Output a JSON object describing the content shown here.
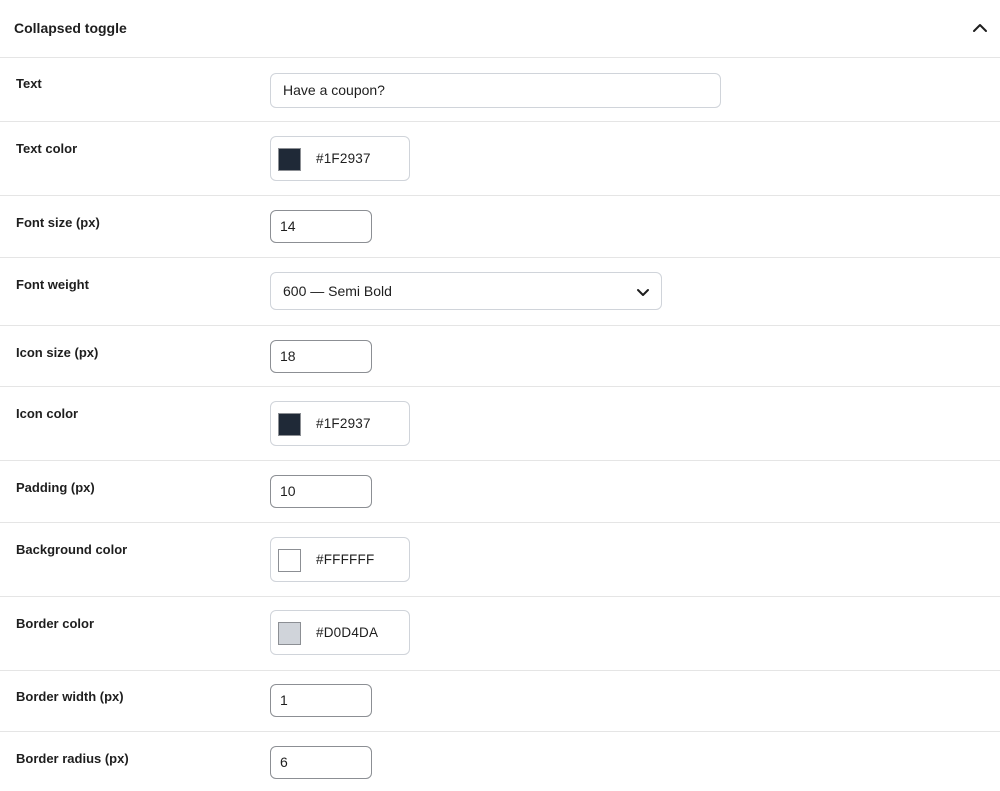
{
  "panel": {
    "title": "Collapsed toggle",
    "collapse_icon": "chevron-up-icon"
  },
  "fields": {
    "text": {
      "label": "Text",
      "value": "Have a coupon?"
    },
    "text_color": {
      "label": "Text color",
      "value": "#1F2937",
      "swatch": "#1F2937"
    },
    "font_size": {
      "label": "Font size (px)",
      "value": "14"
    },
    "font_weight": {
      "label": "Font weight",
      "selected": "600 — Semi Bold",
      "icon": "chevron-down-icon"
    },
    "icon_size": {
      "label": "Icon size (px)",
      "value": "18"
    },
    "icon_color": {
      "label": "Icon color",
      "value": "#1F2937",
      "swatch": "#1F2937"
    },
    "padding": {
      "label": "Padding (px)",
      "value": "10"
    },
    "background_color": {
      "label": "Background color",
      "value": "#FFFFFF",
      "swatch": "#FFFFFF"
    },
    "border_color": {
      "label": "Border color",
      "value": "#D0D4DA",
      "swatch": "#D0D4DA"
    },
    "border_width": {
      "label": "Border width (px)",
      "value": "1"
    },
    "border_radius": {
      "label": "Border radius (px)",
      "value": "6"
    }
  }
}
